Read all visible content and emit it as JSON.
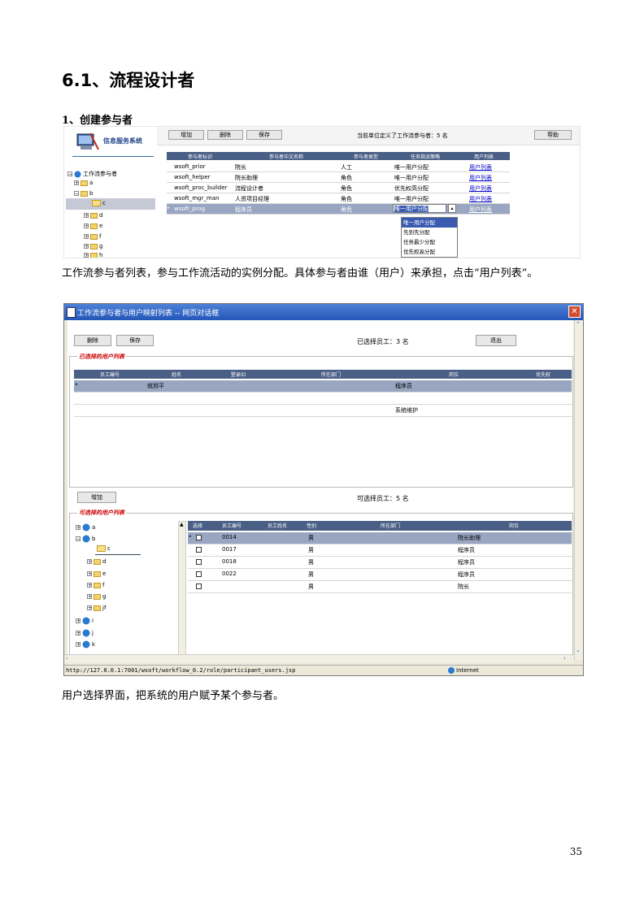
{
  "heading": "6.1、流程设计者",
  "subheading": "1、创建参与者",
  "caption1": "工作流参与者列表，参与工作流活动的实例分配。具体参与者由谁（用户）来承担，点击“用户列表”。",
  "caption2": "用户选择界面，把系统的用户赋予某个参与者。",
  "page_number": "35",
  "screen1": {
    "logo_text": "信息服务系统",
    "tree_root": "工作流参与者",
    "tree": [
      "a",
      "b",
      "c",
      "d",
      "e",
      "f",
      "g",
      "h"
    ],
    "buttons": {
      "add": "增加",
      "delete": "删除",
      "save": "保存",
      "help": "帮助"
    },
    "count_text": "当前单位定义了工作流参与者：5 名",
    "columns": [
      "参与者标识",
      "参与者中文名称",
      "参与者类型",
      "任务指派策略",
      "用户列表"
    ],
    "rows": [
      {
        "id": "wsoft_prior",
        "name": "院长",
        "type": "人工",
        "strategy": "唯一用户分配",
        "link": "用户列表"
      },
      {
        "id": "wsoft_helper",
        "name": "院长助理",
        "type": "角色",
        "strategy": "唯一用户分配",
        "link": "用户列表"
      },
      {
        "id": "wsoft_proc_builder",
        "name": "流程设计者",
        "type": "角色",
        "strategy": "优先权高分配",
        "link": "用户列表"
      },
      {
        "id": "wsoft_mgr_man",
        "name": "人资项目经理",
        "type": "角色",
        "strategy": "唯一用户分配",
        "link": "用户列表"
      },
      {
        "id": "wsoft_prog",
        "name": "程序员",
        "type": "角色",
        "strategy": "唯一用户分配",
        "link": "用户列表"
      }
    ],
    "dropdown_options": [
      "唯一用户分配",
      "先到先分配",
      "任务最少分配",
      "优先权高分配"
    ]
  },
  "screen2": {
    "title": "工作流参与者与用户映射列表 -- 网页对话框",
    "buttons": {
      "delete": "删除",
      "save": "保存",
      "exit": "退出",
      "add": "增加"
    },
    "selected_count": "已选择员工：3 名",
    "selected_group": "已选择的用户列表",
    "selected_columns": [
      "员工编号",
      "姓名",
      "登录ID",
      "所在部门",
      "岗位",
      "优先权"
    ],
    "selected_rows": [
      {
        "name": "就旭平",
        "post": "程序员"
      },
      {
        "name": "",
        "post": ""
      },
      {
        "name": "",
        "post": "系统维护"
      }
    ],
    "available_count": "可选择员工：5 名",
    "available_group": "可选择的用户列表",
    "tree": [
      "a",
      "b",
      "c",
      "d",
      "e",
      "f",
      "g",
      "jf",
      "i",
      "j",
      "k"
    ],
    "available_columns": [
      "选择",
      "员工编号",
      "员工姓名",
      "性别",
      "所在部门",
      "岗位"
    ],
    "available_rows": [
      {
        "no": "0014",
        "sex": "男",
        "post": "院长助理"
      },
      {
        "no": "0017",
        "sex": "男",
        "post": "程序员"
      },
      {
        "no": "0018",
        "sex": "男",
        "post": "程序员"
      },
      {
        "no": "0022",
        "sex": "男",
        "post": "程序员"
      },
      {
        "no": "",
        "sex": "男",
        "post": "院长"
      }
    ],
    "status_url": "http://127.0.0.1:7001/wsoft/workflow_0.2/role/participant_users.jsp",
    "status_zone": "Internet"
  }
}
